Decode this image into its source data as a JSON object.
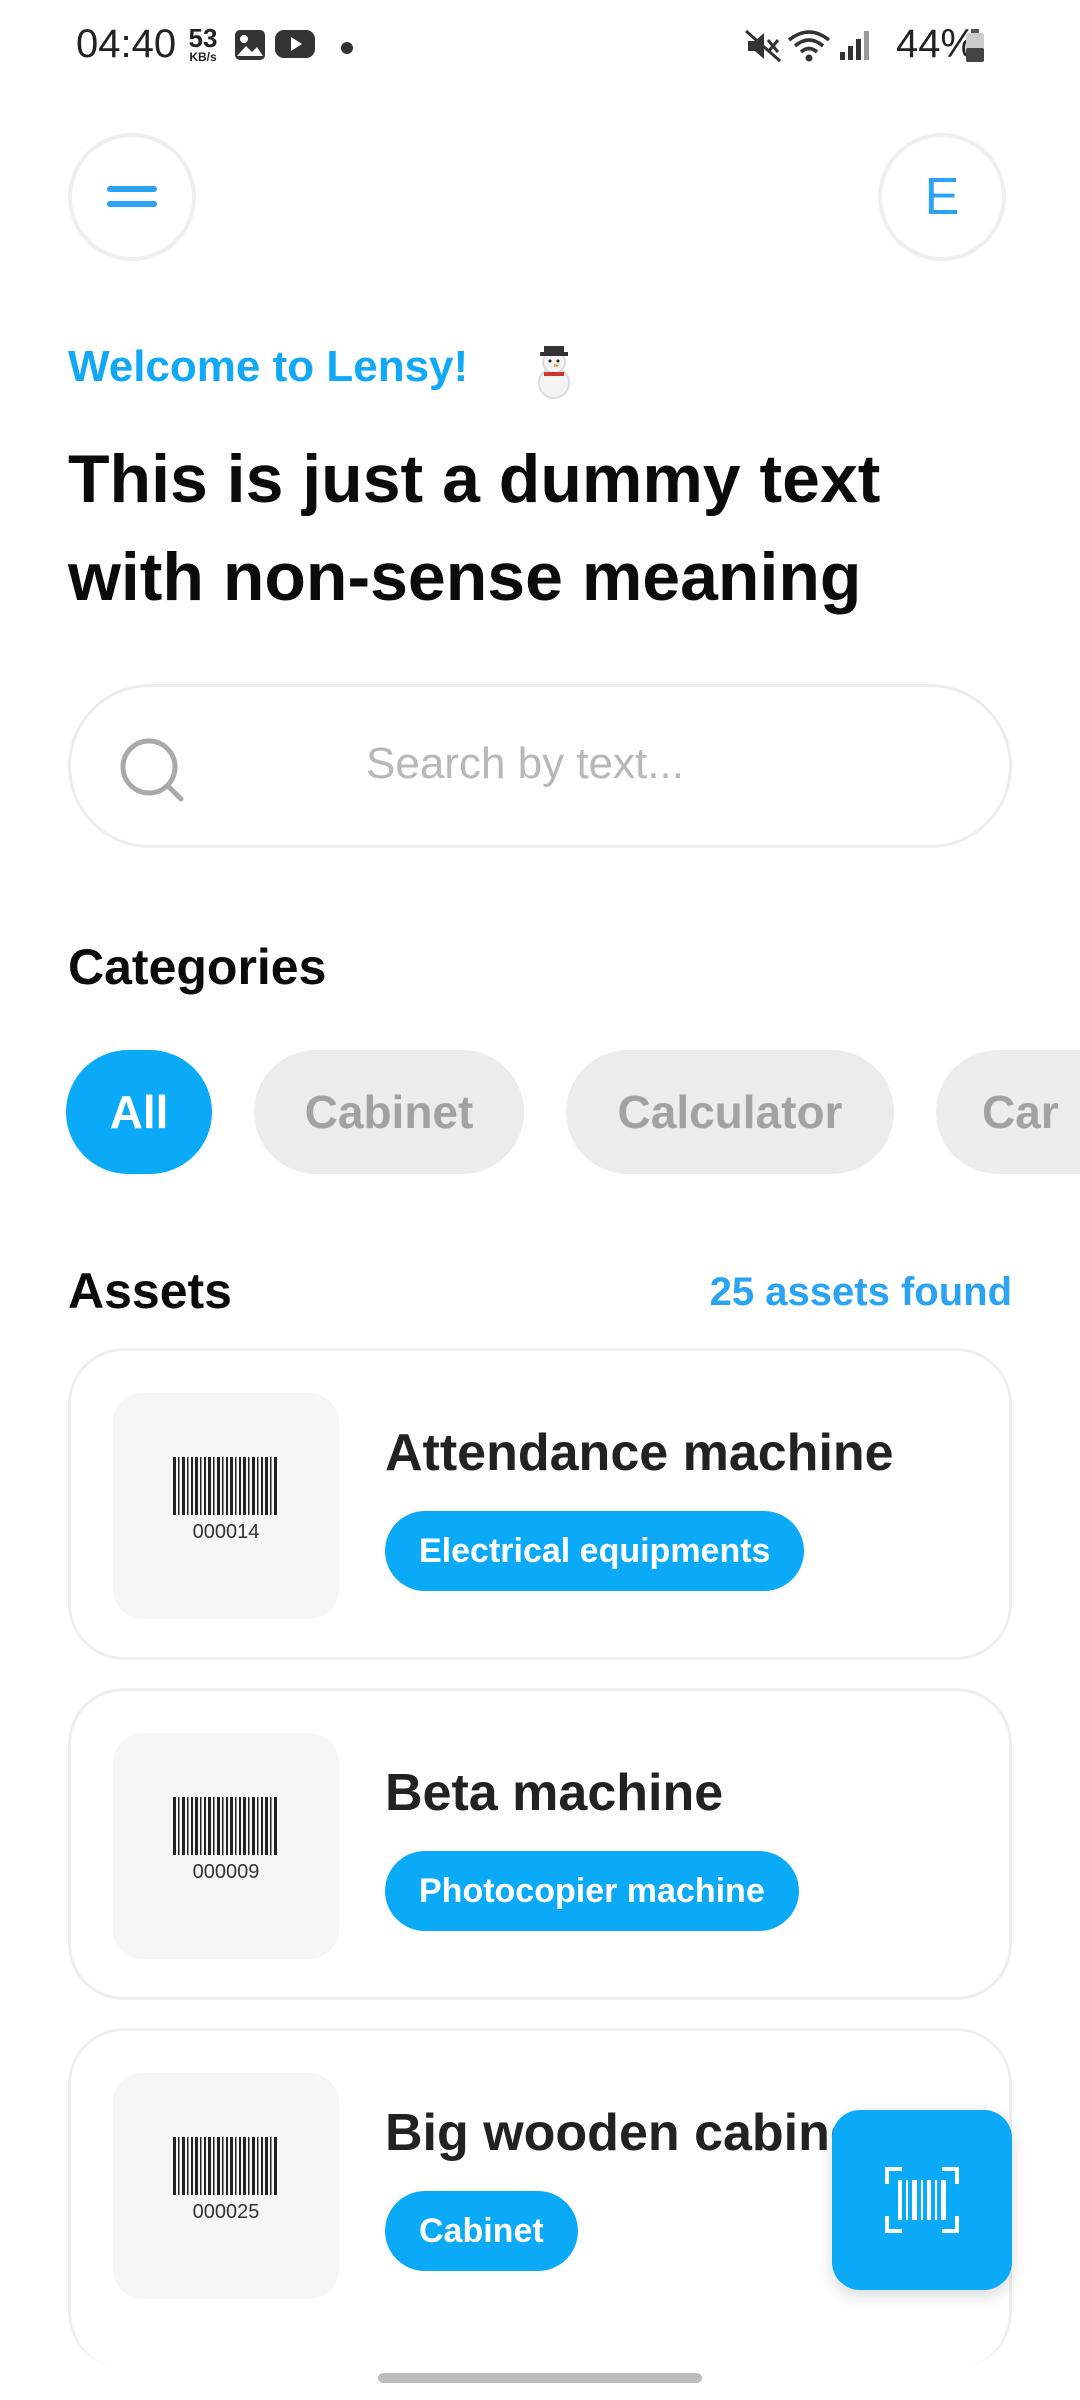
{
  "status_bar": {
    "time": "04:40",
    "net_speed_value": "53",
    "net_speed_unit": "KB/s",
    "battery": "44%"
  },
  "header": {
    "menu_icon": "hamburger-icon",
    "avatar_initial": "E"
  },
  "welcome": {
    "text": "Welcome to Lensy!",
    "emoji": "snowman"
  },
  "headline": "This is just a dummy text with non-sense meaning",
  "search": {
    "placeholder": "Search by text..."
  },
  "categories": {
    "title": "Categories",
    "items": [
      {
        "label": "All",
        "active": true
      },
      {
        "label": "Cabinet",
        "active": false
      },
      {
        "label": "Calculator",
        "active": false
      },
      {
        "label": "Car",
        "active": false
      }
    ]
  },
  "assets": {
    "title": "Assets",
    "count_text": "25 assets found",
    "items": [
      {
        "name": "Attendance machine",
        "category": "Electrical equipments",
        "code": "000014"
      },
      {
        "name": "Beta machine",
        "category": "Photocopier machine",
        "code": "000009"
      },
      {
        "name": "Big wooden cabinet",
        "category": "Cabinet",
        "code": "000025"
      }
    ]
  },
  "fab": {
    "icon": "barcode-scan-icon"
  },
  "colors": {
    "accent": "#0aaaf8",
    "accent_text": "#2aa3f3",
    "chip_inactive_bg": "#ececec",
    "chip_inactive_text": "#a2a2a2"
  }
}
